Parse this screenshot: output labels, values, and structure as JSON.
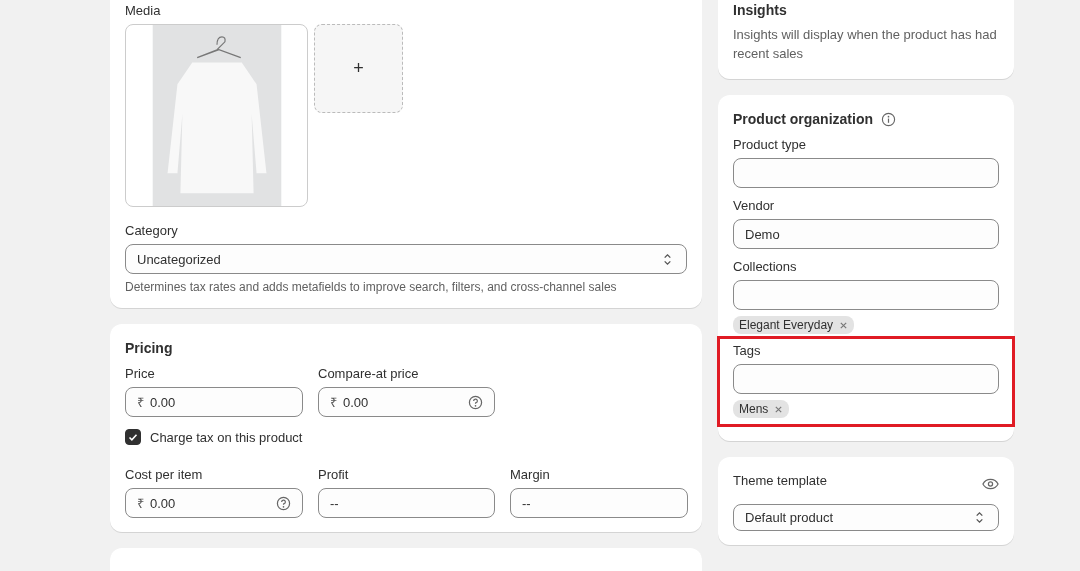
{
  "media": {
    "label": "Media",
    "add": "+"
  },
  "category": {
    "label": "Category",
    "value": "Uncategorized",
    "help": "Determines tax rates and adds metafields to improve search, filters, and cross-channel sales"
  },
  "pricing": {
    "title": "Pricing",
    "top_fields": [
      {
        "label": "Price",
        "currency": "₹",
        "value": "0.00",
        "help_icon": false
      },
      {
        "label": "Compare-at price",
        "currency": "₹",
        "value": "0.00",
        "help_icon": true
      }
    ],
    "charge_tax": {
      "label": "Charge tax on this product",
      "checked": true
    },
    "bottom_fields": [
      {
        "label": "Cost per item",
        "currency": "₹",
        "value": "0.00",
        "help_icon": true
      },
      {
        "label": "Profit",
        "value": "--",
        "help_icon": false
      },
      {
        "label": "Margin",
        "value": "--",
        "help_icon": false
      }
    ]
  },
  "insights": {
    "title": "Insights",
    "text": "Insights will display when the product has had recent sales"
  },
  "organization": {
    "title": "Product organization",
    "fields": [
      {
        "label": "Product type",
        "highlighted": false
      },
      {
        "label": "Vendor",
        "value": "Demo",
        "highlighted": false
      },
      {
        "label": "Collections",
        "tags": [
          "Elegant Everyday"
        ],
        "highlighted": false
      },
      {
        "label": "Tags",
        "tags": [
          "Mens"
        ],
        "highlighted": true
      }
    ]
  },
  "theme": {
    "label": "Theme template",
    "value": "Default product"
  }
}
